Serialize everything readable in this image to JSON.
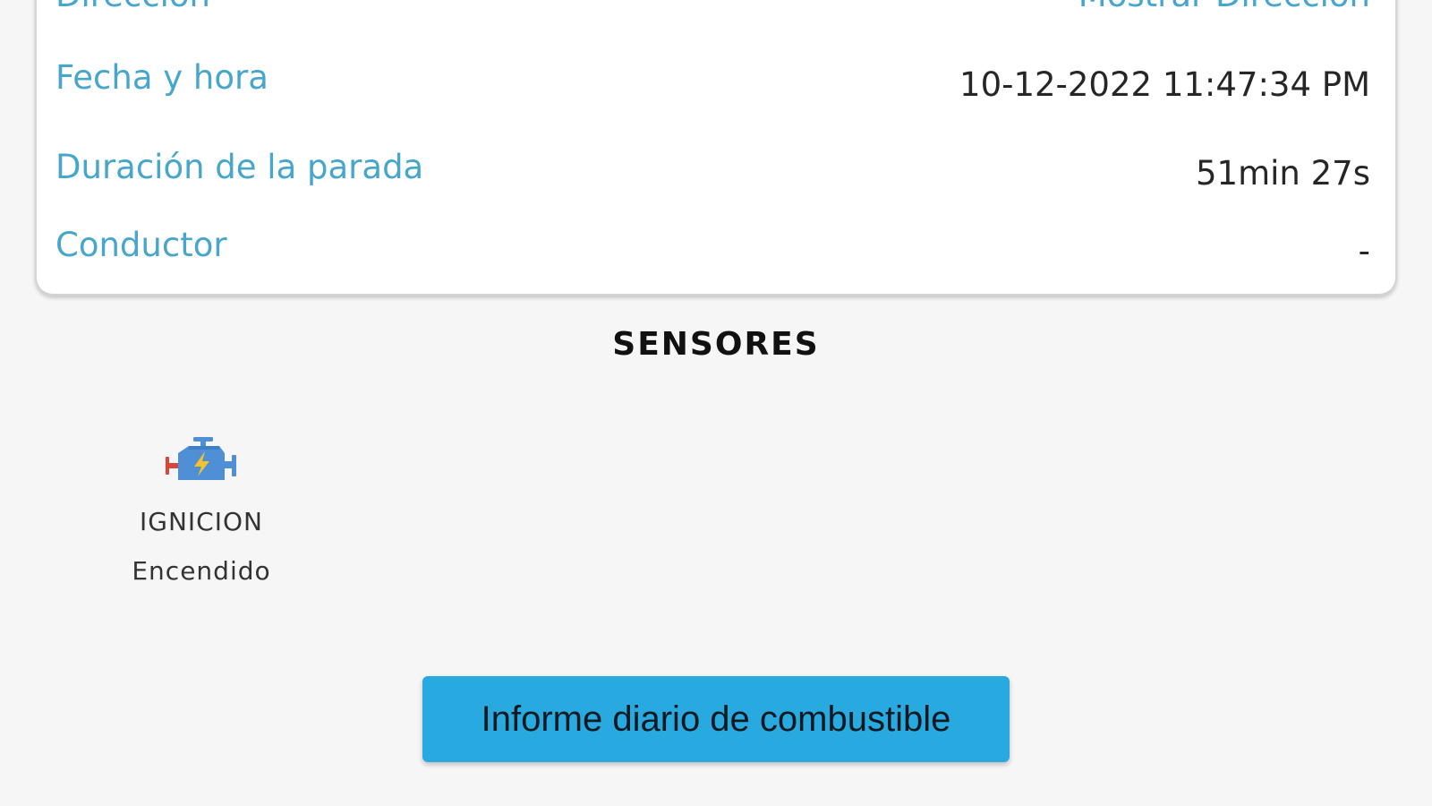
{
  "details": {
    "address_label": "Dirección",
    "address_link": "Mostrar Dirección",
    "datetime_label": "Fecha y hora",
    "datetime_value": "10-12-2022 11:47:34 PM",
    "stop_duration_label": "Duración de la parada",
    "stop_duration_value": "51min 27s",
    "driver_label": "Conductor",
    "driver_value": "-"
  },
  "sensors": {
    "title": "SENSORES",
    "items": [
      {
        "icon": "engine-icon",
        "name": "IGNICION",
        "state": "Encendido"
      }
    ]
  },
  "actions": {
    "fuel_report_label": "Informe diario de combustible"
  },
  "colors": {
    "label": "#46a6cc",
    "button": "#28a9df",
    "background": "#f6f6f6"
  }
}
